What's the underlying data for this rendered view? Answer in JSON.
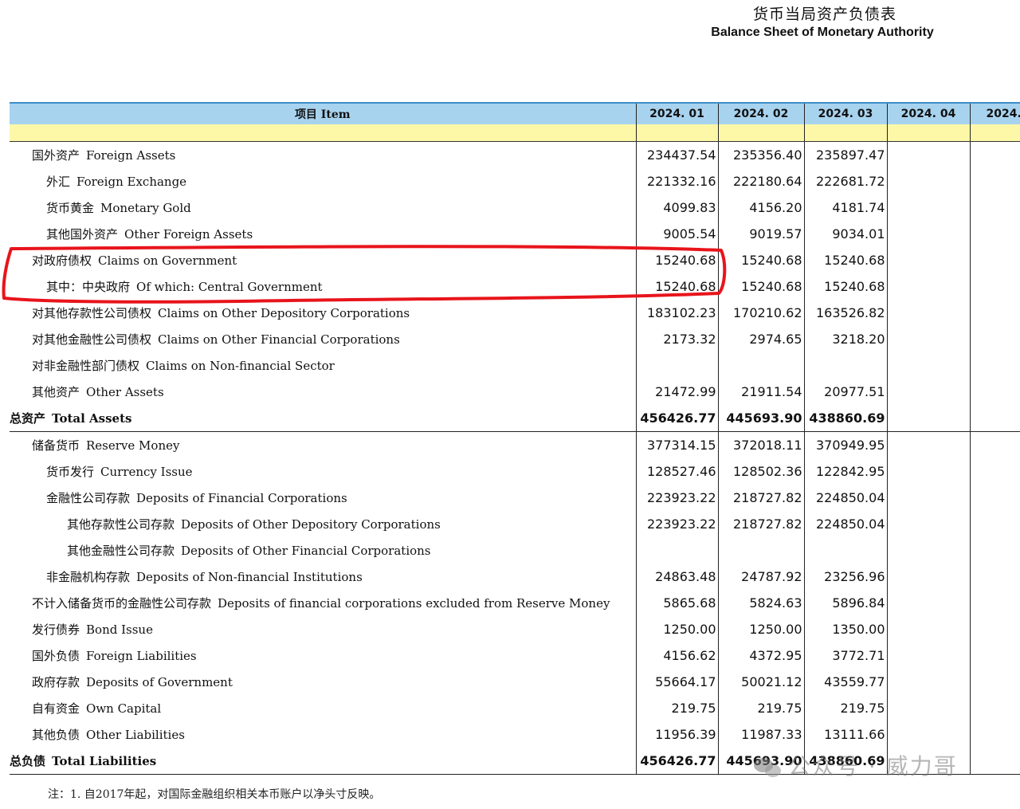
{
  "title_zh": "货币当局资产负债表",
  "title_en": "Balance Sheet of  Monetary Authority",
  "header": {
    "item": "项目  Item",
    "periods": [
      "2024. 01",
      "2024. 02",
      "2024. 03",
      "2024. 04",
      "2024."
    ]
  },
  "rows": [
    {
      "zh": "国外资产",
      "en": "Foreign Assets",
      "level": 1,
      "values": [
        "234437.54",
        "235356.40",
        "235897.47",
        "",
        ""
      ]
    },
    {
      "zh": "外汇",
      "en": "Foreign Exchange",
      "level": 2,
      "values": [
        "221332.16",
        "222180.64",
        "222681.72",
        "",
        ""
      ]
    },
    {
      "zh": "货币黄金",
      "en": "Monetary Gold",
      "level": 2,
      "values": [
        "4099.83",
        "4156.20",
        "4181.74",
        "",
        ""
      ]
    },
    {
      "zh": "其他国外资产",
      "en": "Other Foreign Assets",
      "level": 2,
      "values": [
        "9005.54",
        "9019.57",
        "9034.01",
        "",
        ""
      ]
    },
    {
      "zh": "对政府债权",
      "en": "Claims on Government",
      "level": 1,
      "values": [
        "15240.68",
        "15240.68",
        "15240.68",
        "",
        ""
      ]
    },
    {
      "zh": "其中：中央政府",
      "en": "Of which: Central Government",
      "level": 2,
      "values": [
        "15240.68",
        "15240.68",
        "15240.68",
        "",
        ""
      ]
    },
    {
      "zh": "对其他存款性公司债权",
      "en": "Claims on Other Depository Corporations",
      "level": 1,
      "values": [
        "183102.23",
        "170210.62",
        "163526.82",
        "",
        ""
      ]
    },
    {
      "zh": "对其他金融性公司债权",
      "en": "Claims on Other Financial Corporations",
      "level": 1,
      "values": [
        "2173.32",
        "2974.65",
        "3218.20",
        "",
        ""
      ]
    },
    {
      "zh": "对非金融性部门债权",
      "en": "Claims on Non-financial Sector",
      "level": 1,
      "values": [
        "",
        "",
        "",
        "",
        ""
      ]
    },
    {
      "zh": "其他资产",
      "en": "Other Assets",
      "level": 1,
      "values": [
        "21472.99",
        "21911.54",
        "20977.51",
        "",
        ""
      ]
    },
    {
      "zh": "总资产",
      "en": "Total Assets",
      "level": 0,
      "values": [
        "456426.77",
        "445693.90",
        "438860.69",
        "",
        ""
      ]
    },
    {
      "zh": "储备货币",
      "en": "Reserve Money",
      "level": 1,
      "values": [
        "377314.15",
        "372018.11",
        "370949.95",
        "",
        ""
      ]
    },
    {
      "zh": "货币发行",
      "en": "Currency Issue",
      "level": 2,
      "values": [
        "128527.46",
        "128502.36",
        "122842.95",
        "",
        ""
      ]
    },
    {
      "zh": "金融性公司存款",
      "en": "Deposits of  Financial Corporations",
      "level": 2,
      "values": [
        "223923.22",
        "218727.82",
        "224850.04",
        "",
        ""
      ]
    },
    {
      "zh": "其他存款性公司存款",
      "en": "Deposits of  Other Depository Corporations",
      "level": 3,
      "values": [
        "223923.22",
        "218727.82",
        "224850.04",
        "",
        ""
      ]
    },
    {
      "zh": "其他金融性公司存款",
      "en": "Deposits of  Other Financial Corporations",
      "level": 3,
      "values": [
        "",
        "",
        "",
        "",
        ""
      ]
    },
    {
      "zh": "非金融机构存款",
      "en": "Deposits of  Non-financial Institutions",
      "level": 2,
      "values": [
        "24863.48",
        "24787.92",
        "23256.96",
        "",
        ""
      ]
    },
    {
      "zh": "不计入储备货币的金融性公司存款",
      "en": "Deposits of financial corporations excluded from Reserve Money",
      "level": 1,
      "values": [
        "5865.68",
        "5824.63",
        "5896.84",
        "",
        ""
      ]
    },
    {
      "zh": "发行债券",
      "en": "Bond Issue",
      "level": 1,
      "values": [
        "1250.00",
        "1250.00",
        "1350.00",
        "",
        ""
      ]
    },
    {
      "zh": "国外负债",
      "en": "Foreign Liabilities",
      "level": 1,
      "values": [
        "4156.62",
        "4372.95",
        "3772.71",
        "",
        ""
      ]
    },
    {
      "zh": "政府存款",
      "en": "Deposits of Government",
      "level": 1,
      "values": [
        "55664.17",
        "50021.12",
        "43559.77",
        "",
        ""
      ]
    },
    {
      "zh": "自有资金",
      "en": "Own Capital",
      "level": 1,
      "values": [
        "219.75",
        "219.75",
        "219.75",
        "",
        ""
      ]
    },
    {
      "zh": "其他负债",
      "en": "Other Liabilities",
      "level": 1,
      "values": [
        "11956.39",
        "11987.33",
        "13111.66",
        "",
        ""
      ]
    },
    {
      "zh": "总负债",
      "en": "Total  Liabilities",
      "level": 0,
      "values": [
        "456426.77",
        "445693.90",
        "438860.69",
        "",
        ""
      ]
    }
  ],
  "watermark": "公众号 · 威力哥",
  "note": "注：1. 自2017年起，对国际金融组织相关本币账户以净头寸反映。",
  "colors": {
    "header_bg": "#a8d3ef",
    "yellow_band": "#fdf8a8",
    "highlight": "#e8141b"
  }
}
